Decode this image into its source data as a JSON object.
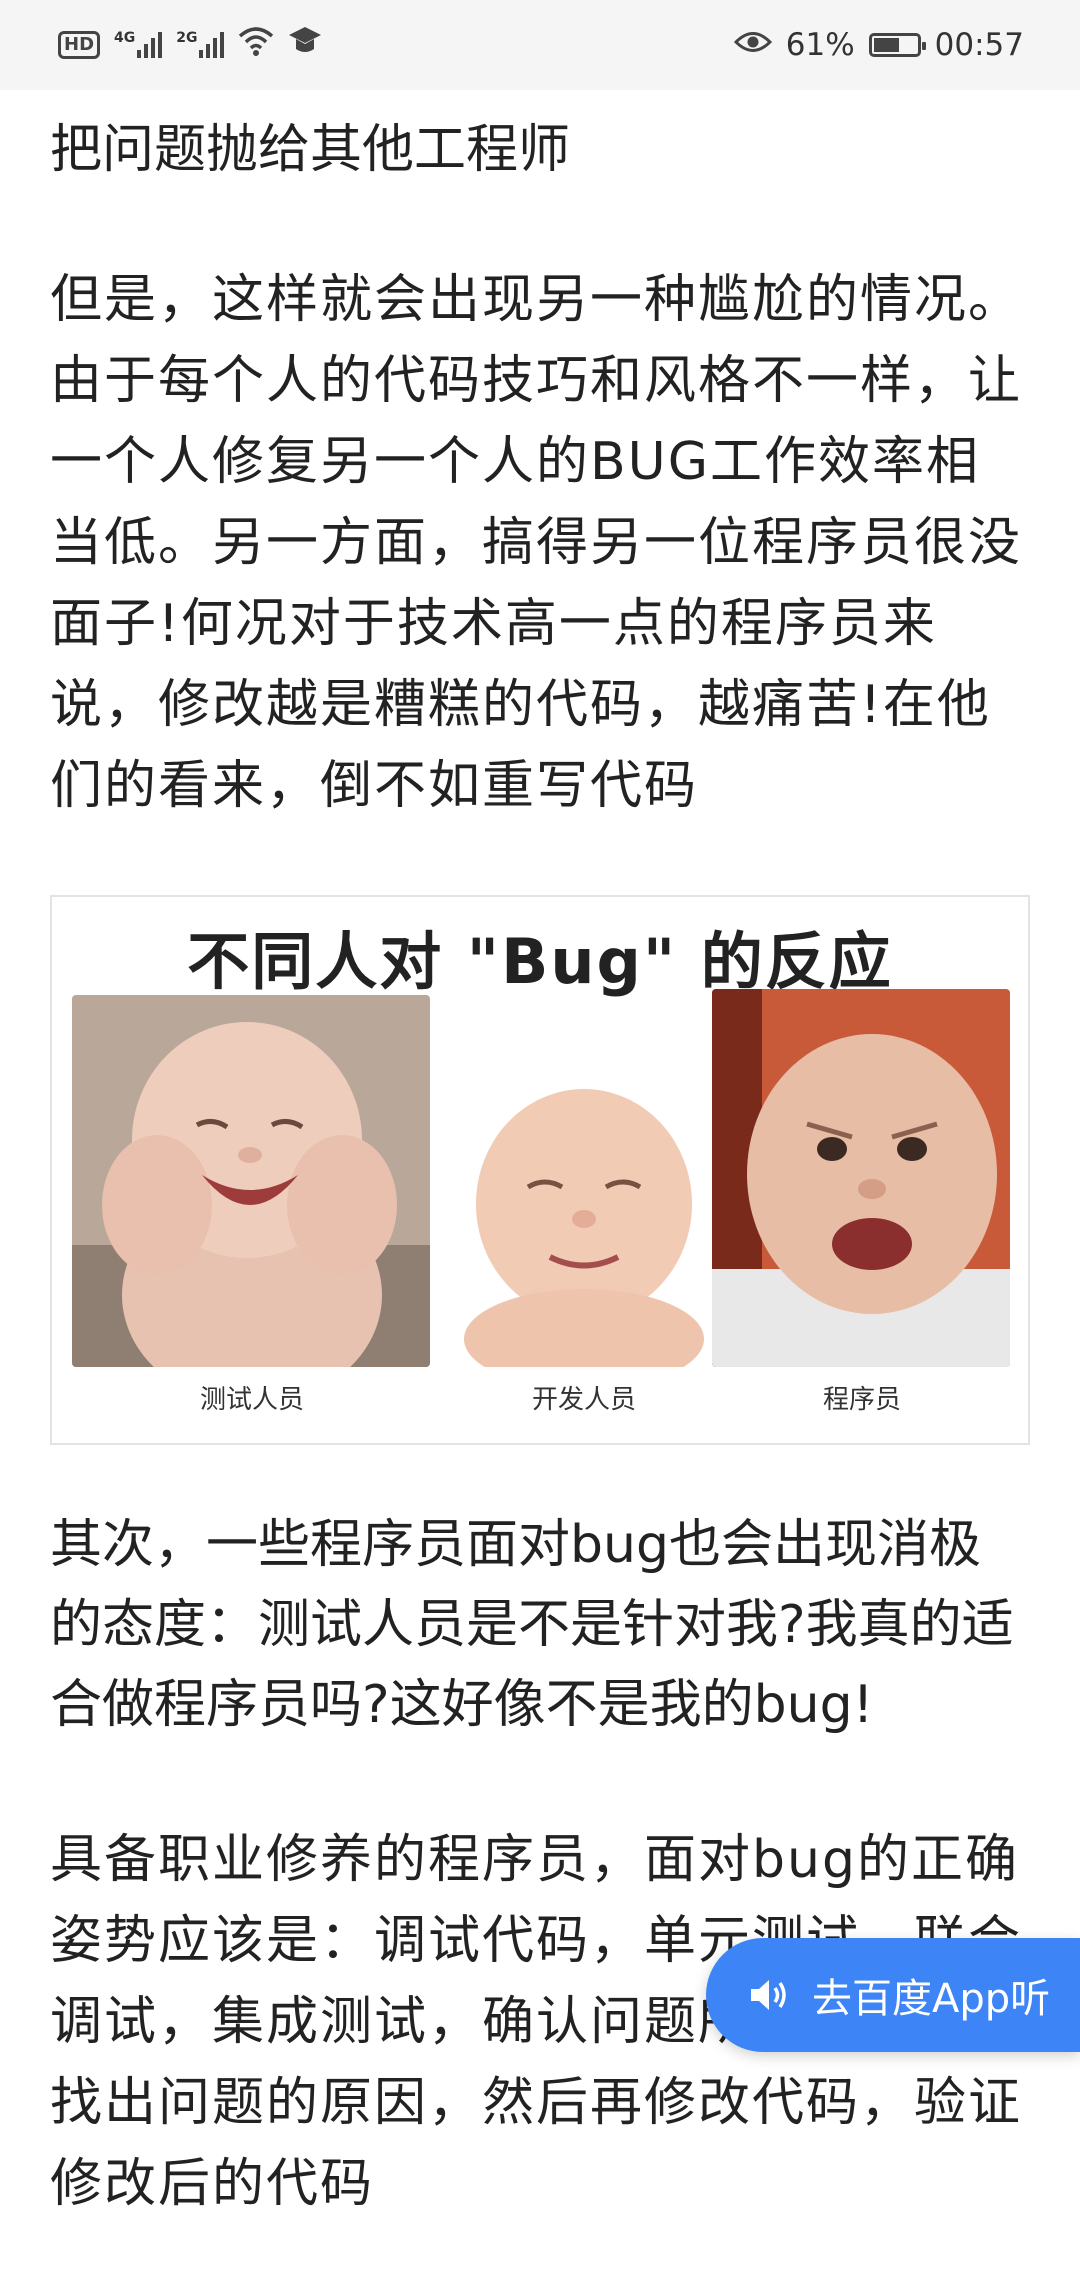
{
  "status_bar": {
    "hd": "HD",
    "net1": "4G",
    "net2": "2G",
    "battery_text": "61%",
    "battery_level": 0.61,
    "time": "00:57"
  },
  "article": {
    "p1": "把问题抛给其他工程师",
    "p2": "但是，这样就会出现另一种尴尬的情况。由于每个人的代码技巧和风格不一样，让一个人修复另一个人的BUG工作效率相当低。另一方面，搞得另一位程序员很没面子!何况对于技术高一点的程序员来说，修改越是糟糕的代码，越痛苦!在他们的看来，倒不如重写代码",
    "figure": {
      "title": "不同人对 \"Bug\" 的反应",
      "captions": [
        "测试人员",
        "开发人员",
        "程序员"
      ]
    },
    "p3": "其次，一些程序员面对bug也会出现消极的态度：测试人员是不是针对我?我真的适合做程序员吗?这好像不是我的bug!",
    "p4": "具备职业修养的程序员，面对bug的正确姿势应该是：调试代码，单元测试，联合调试，集成测试，确认问题所在，进一步找出问题的原因，然后再修改代码，验证修改后的代码"
  },
  "listen_button": {
    "label": "去百度App听",
    "icon": "speaker-icon",
    "color": "#3d84f6"
  }
}
